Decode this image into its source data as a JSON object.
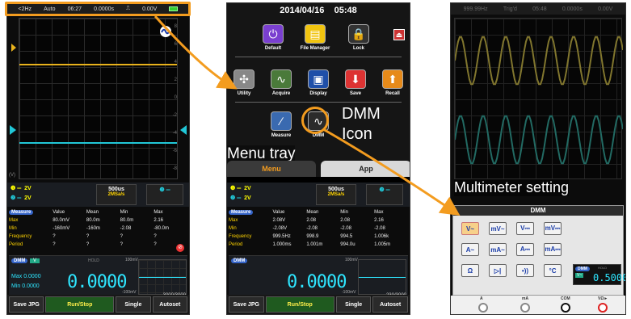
{
  "screen1": {
    "status": {
      "freq": "<2Hz",
      "trig": "Auto",
      "time": "06:27",
      "offset": "0.0000s",
      "slope": "⎍",
      "level": "0.00V"
    },
    "y_ticks": [
      "8",
      "6",
      "4",
      "2",
      "0",
      "-2",
      "-4",
      "-6",
      "-8"
    ],
    "axis_unit": "(V)",
    "ch1_scale": "2V",
    "ch2_scale": "2V",
    "timebase": "500us",
    "sample_rate": "2MSa/s",
    "measure": {
      "headers": [
        "Measure",
        "Value",
        "Mean",
        "Min",
        "Max"
      ],
      "rows": [
        [
          "Max",
          "80.0mV",
          "80.0m",
          "80.0m",
          "2.16"
        ],
        [
          "Min",
          "-160mV",
          "-160m",
          "-2.08",
          "-80.0m"
        ],
        [
          "Frequency",
          "?",
          "?",
          "?",
          "?"
        ],
        [
          "Period",
          "?",
          "?",
          "?",
          "?"
        ]
      ]
    },
    "dmm": {
      "badge": "DMM",
      "mode": "V",
      "hold": "HOLD",
      "max_label": "Max",
      "min_label": "Min",
      "max_value": "0.0000",
      "min_value": "0.0000",
      "reading": "0.0000",
      "top": "100mV",
      "bottom": "-100mV"
    },
    "progress": {
      "text": "3000/3000",
      "fraction": 1.0
    },
    "buttons": [
      "Save JPG",
      "Run/Stop",
      "Single",
      "Autoset"
    ]
  },
  "screen2": {
    "date": "2014/04/16",
    "time": "05:48",
    "icons_row1": [
      {
        "label": "Default",
        "icon": "power-icon"
      },
      {
        "label": "File Manager",
        "icon": "folder-icon"
      },
      {
        "label": "Lock",
        "icon": "lock-icon"
      }
    ],
    "icons_row2": [
      {
        "label": "Utility",
        "icon": "tools-icon"
      },
      {
        "label": "Acquire",
        "icon": "wave-icon"
      },
      {
        "label": "Display",
        "icon": "display-icon"
      },
      {
        "label": "Save",
        "icon": "save-icon"
      },
      {
        "label": "Recall",
        "icon": "recall-icon"
      }
    ],
    "icons_row3": [
      {
        "label": "Measure",
        "icon": "measure-icon"
      },
      {
        "label": "DMM",
        "icon": "dmm-icon"
      }
    ],
    "tabs": {
      "menu": "Menu",
      "app": "App"
    },
    "ch1_scale": "2V",
    "ch2_scale": "2V",
    "timebase": "500us",
    "sample_rate": "2MSa/s",
    "measure": {
      "headers": [
        "Measure",
        "Value",
        "Mean",
        "Min",
        "Max"
      ],
      "rows": [
        [
          "Max",
          "2.08V",
          "2.08",
          "2.08",
          "2.16"
        ],
        [
          "Min",
          "-2.08V",
          "-2.08",
          "-2.08",
          "-2.08"
        ],
        [
          "Frequency",
          "999.5Hz",
          "998.9",
          "994.5",
          "1.006k"
        ],
        [
          "Period",
          "1.000ms",
          "1.001m",
          "994.0u",
          "1.005m"
        ]
      ]
    },
    "dmm": {
      "badge": "DMM",
      "reading": "0.0000",
      "top": "100mV",
      "bottom": "-100mV"
    },
    "progress": {
      "text": "230/3000",
      "fraction": 0.077
    },
    "buttons": [
      "Save JPG",
      "Run/Stop",
      "Single",
      "Autoset"
    ]
  },
  "screen3": {
    "status": {
      "freq": "999.99Hz",
      "trig": "Trig'd",
      "time": "05:48",
      "offset": "0.0000s",
      "level": "0.00V"
    },
    "dmm_title": "DMM",
    "buttons": [
      "V~",
      "mV~",
      "V⎓",
      "mV⎓",
      "A~",
      "mA~",
      "A⎓",
      "mA⎓",
      "Ω",
      "▷|",
      "•))",
      "°C"
    ],
    "readout": {
      "badge": "DMM",
      "mode": "V~",
      "hold": "HOLD",
      "value": "0.5000"
    },
    "terminals": [
      "A",
      "mA",
      "COM",
      "VΩ►"
    ]
  },
  "callouts": {
    "dmm_icon": "DMM\nIcon",
    "menu_tray": "Menu tray",
    "multimeter": "Multimeter setting"
  },
  "colors": {
    "highlight": "#f39c1f",
    "ch1": "#e8b21c",
    "ch2": "#21c8d8",
    "dmm_text": "#2ee6ff"
  }
}
